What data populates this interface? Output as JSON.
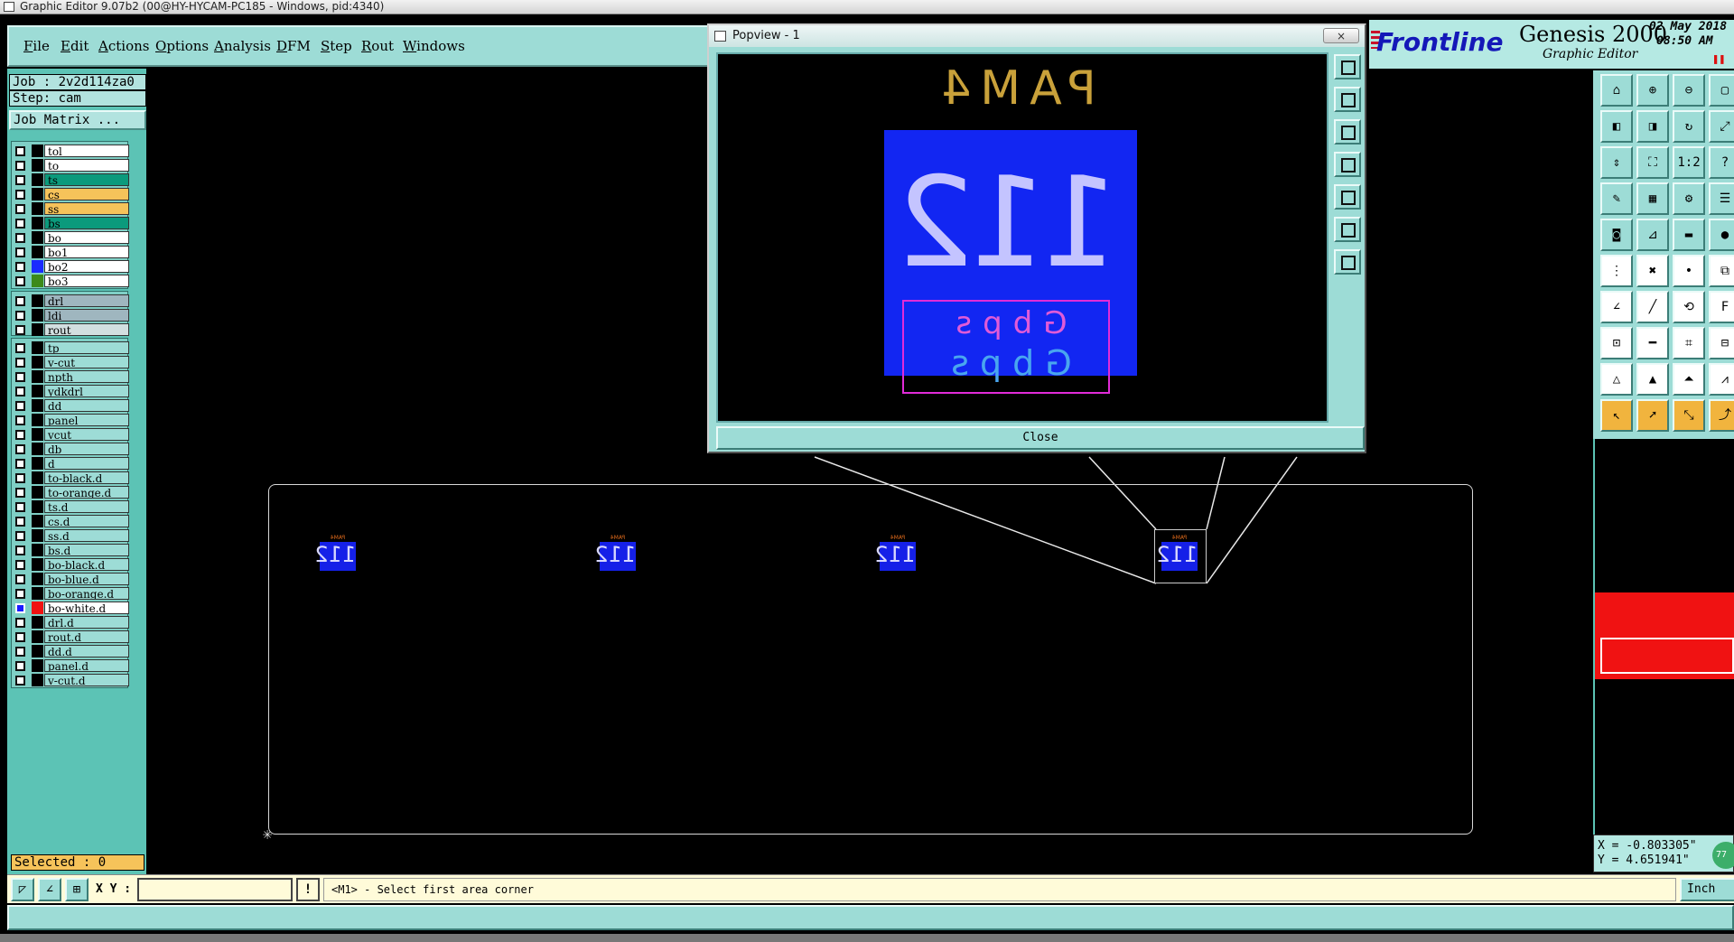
{
  "window": {
    "title": "Graphic Editor 9.07b2 (00@HY-HYCAM-PC185 - Windows, pid:4340)"
  },
  "menu": [
    "File",
    "Edit",
    "Actions",
    "Options",
    "Analysis",
    "DFM",
    "Step",
    "Rout",
    "Windows"
  ],
  "info": {
    "job": "Job : 2v2d114za0",
    "step": "Step: cam",
    "job_matrix": "Job Matrix ..."
  },
  "layers": {
    "group1": [
      {
        "name": "tol",
        "color": "#ffffff",
        "swatch": "#000000",
        "checked": false
      },
      {
        "name": "to",
        "color": "#ffffff",
        "swatch": "#000000",
        "checked": false
      },
      {
        "name": "ts",
        "color": "#0b9a7c",
        "swatch": "#000000",
        "checked": false
      },
      {
        "name": "cs",
        "color": "#f6c35a",
        "swatch": "#000000",
        "checked": false
      },
      {
        "name": "ss",
        "color": "#f6c35a",
        "swatch": "#000000",
        "checked": false
      },
      {
        "name": "bs",
        "color": "#0b9a7c",
        "swatch": "#000000",
        "checked": false
      },
      {
        "name": "bo",
        "color": "#ffffff",
        "swatch": "#000000",
        "checked": false
      },
      {
        "name": "bo1",
        "color": "#ffffff",
        "swatch": "#000000",
        "checked": false
      },
      {
        "name": "bo2",
        "color": "#ffffff",
        "swatch": "#1a2bff",
        "checked": false
      },
      {
        "name": "bo3",
        "color": "#ffffff",
        "swatch": "#3c8a1a",
        "checked": false
      }
    ],
    "group2": [
      {
        "name": "drl",
        "color": "#9fb6bf",
        "swatch": "#000000",
        "checked": false
      },
      {
        "name": "ldi",
        "color": "#9fb6bf",
        "swatch": "#000000",
        "checked": false
      },
      {
        "name": "rout",
        "color": "#d2dfe0",
        "swatch": "#000000",
        "checked": false
      }
    ],
    "group3": [
      {
        "name": "tp",
        "color": "#9ddcd6",
        "swatch": "#000000",
        "checked": false
      },
      {
        "name": "v-cut",
        "color": "#9ddcd6",
        "swatch": "#000000",
        "checked": false
      },
      {
        "name": "npth",
        "color": "#9ddcd6",
        "swatch": "#000000",
        "checked": false
      },
      {
        "name": "ydkdrl",
        "color": "#9ddcd6",
        "swatch": "#000000",
        "checked": false
      },
      {
        "name": "dd",
        "color": "#9ddcd6",
        "swatch": "#000000",
        "checked": false
      },
      {
        "name": "panel",
        "color": "#9ddcd6",
        "swatch": "#000000",
        "checked": false
      },
      {
        "name": "vcut",
        "color": "#9ddcd6",
        "swatch": "#000000",
        "checked": false
      },
      {
        "name": "db",
        "color": "#9ddcd6",
        "swatch": "#000000",
        "checked": false
      },
      {
        "name": "d",
        "color": "#9ddcd6",
        "swatch": "#000000",
        "checked": false
      },
      {
        "name": "to-black.d",
        "color": "#9ddcd6",
        "swatch": "#000000",
        "checked": false
      },
      {
        "name": "to-orange.d",
        "color": "#9ddcd6",
        "swatch": "#000000",
        "checked": false
      },
      {
        "name": "ts.d",
        "color": "#9ddcd6",
        "swatch": "#000000",
        "checked": false
      },
      {
        "name": "cs.d",
        "color": "#9ddcd6",
        "swatch": "#000000",
        "checked": false
      },
      {
        "name": "ss.d",
        "color": "#9ddcd6",
        "swatch": "#000000",
        "checked": false
      },
      {
        "name": "bs.d",
        "color": "#9ddcd6",
        "swatch": "#000000",
        "checked": false
      },
      {
        "name": "bo-black.d",
        "color": "#9ddcd6",
        "swatch": "#000000",
        "checked": false
      },
      {
        "name": "bo-blue.d",
        "color": "#9ddcd6",
        "swatch": "#000000",
        "checked": false
      },
      {
        "name": "bo-orange.d",
        "color": "#9ddcd6",
        "swatch": "#000000",
        "checked": false
      },
      {
        "name": "bo-white.d",
        "color": "#ffffff",
        "swatch": "#f01212",
        "checked": true
      },
      {
        "name": "drl.d",
        "color": "#9ddcd6",
        "swatch": "#000000",
        "checked": false
      },
      {
        "name": "rout.d",
        "color": "#9ddcd6",
        "swatch": "#000000",
        "checked": false
      },
      {
        "name": "dd.d",
        "color": "#9ddcd6",
        "swatch": "#000000",
        "checked": false
      },
      {
        "name": "panel.d",
        "color": "#9ddcd6",
        "swatch": "#000000",
        "checked": false
      },
      {
        "name": "v-cut.d",
        "color": "#9ddcd6",
        "swatch": "#000000",
        "checked": false
      }
    ]
  },
  "selected": "Selected : 0",
  "popview": {
    "title": "Popview - 1",
    "close_button": "Close",
    "title_close_glyph": "×",
    "pam4_text": "PAM4",
    "big_number": "112",
    "gbps_line1": "Gbps",
    "gbps_line2": "Gbps"
  },
  "thumbnails": [
    {
      "label": "PAM4",
      "number": "112"
    },
    {
      "label": "PAM4",
      "number": "112"
    },
    {
      "label": "PAM4",
      "number": "112"
    },
    {
      "label": "PAM4",
      "number": "112"
    }
  ],
  "brand": {
    "logo": "Frontline",
    "product": "Genesis 2000",
    "subtitle": "Graphic Editor",
    "date": "02 May 2018",
    "time": "08:50 AM"
  },
  "toolbar_icons": [
    "zoom-home-icon",
    "zoom-in-icon",
    "zoom-out-icon",
    "window-icon",
    "pan-left-icon",
    "pan-right-icon",
    "redraw-icon",
    "fit-icon",
    "fit-height-icon",
    "zoom-fit-icon",
    "scale-1-1-icon",
    "help-icon",
    "snap-icon",
    "grid-icon",
    "measure-icon",
    "layers-icon",
    "pad-icon",
    "angle-icon",
    "ruler-icon",
    "dot-icon",
    "nodes-icon",
    "cross-icon",
    "point-icon",
    "split-icon",
    "line-icon",
    "diagonal-icon",
    "arc-icon",
    "frontline-icon",
    "square-icon",
    "minus-icon",
    "bracket-icon",
    "connector-icon",
    "triangle-icon",
    "triangle-a-icon",
    "triangle-b-icon",
    "triangle-c-icon",
    "pointer-icon",
    "select-icon",
    "move-icon",
    "route-icon"
  ],
  "coords": {
    "x": "X = -0.803305\"",
    "y": "Y = 4.651941\""
  },
  "globe_label": "77",
  "command_bar": {
    "xy_label": "X Y :",
    "xy_value": "",
    "bang": "!",
    "prompt": "<M1> - Select first area corner",
    "units": "Inch"
  },
  "colors": {
    "panel": "#5cc3b5",
    "menu": "#9ddcd6",
    "selected": "#f6c35a",
    "accent_red": "#f01212",
    "pcb_blue": "#1226f2"
  }
}
